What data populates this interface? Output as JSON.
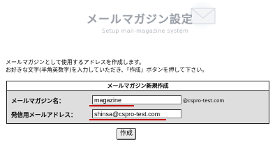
{
  "header": {
    "title": "メールマガジン設定",
    "subtitle": "Setup mail-magazine system"
  },
  "intro": {
    "line1": "メールマガジンとして使用するアドレスを作成します。",
    "line2": "お好きな文字(半角英数字)を入力していただき、「作成」ボタンを押して下さい。"
  },
  "form": {
    "title": "メールマガジン新規作成",
    "magazine_name_label": "メールマガジン名：",
    "magazine_name_value": "magazine",
    "domain_suffix": "@cspro-test.com",
    "sender_address_label": "発信用メールアドレス：",
    "sender_address_value": "shinsa@cspro-test.com",
    "submit_label": "作成"
  },
  "colors": {
    "title_gray": "#9aa0a8",
    "panel_bg": "#dedede",
    "underline_red": "#c80000"
  },
  "icons": {
    "header_decoration": "envelope-icon"
  }
}
